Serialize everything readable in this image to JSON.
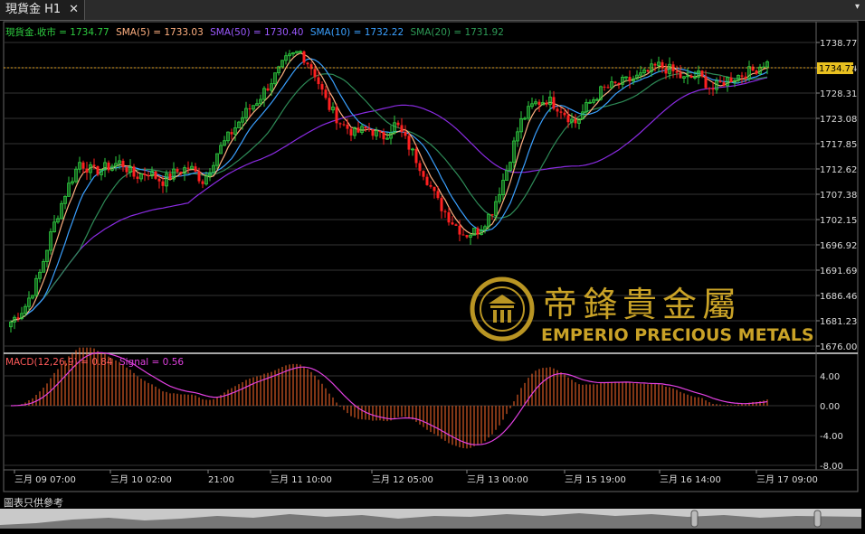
{
  "tab": {
    "label": "現貨金 H1",
    "close": "✕",
    "menu": "▾"
  },
  "legend": {
    "symbol": "現貨金.收市 = 1734.77",
    "sma5": "SMA(5) = 1733.03",
    "sma50": "SMA(50) = 1730.40",
    "sma10": "SMA(10) = 1732.22",
    "sma20": "SMA(20) = 1731.92"
  },
  "macd_legend": {
    "macd": "MACD(12,26,9) = 0.84",
    "signal": "Signal = 0.56"
  },
  "price_label": "1734.77",
  "disclaimer": "圖表只供參考",
  "watermark": {
    "name": "帝鋒貴金屬",
    "english": "EMPERIO PRECIOUS METALS"
  },
  "colors": {
    "up": "#2ecc40",
    "down": "#ff2020",
    "sma5": "#ffb080",
    "sma10": "#3aa0ff",
    "sma20": "#2e8b57",
    "sma50": "#8a2be2",
    "macd_hist": "#ff6a2a",
    "signal": "#e040e0",
    "gold": "#c9a227"
  },
  "chart_data": {
    "type": "candlestick",
    "price_axis": {
      "ticks": [
        "1738.77",
        "1733.54",
        "1728.31",
        "1723.08",
        "1717.85",
        "1712.62",
        "1707.38",
        "1702.15",
        "1696.92",
        "1691.69",
        "1686.46",
        "1681.23",
        "1676.00"
      ],
      "range": [
        1676.0,
        1741.0
      ]
    },
    "macd_axis": {
      "ticks": [
        "4.00",
        "0.00",
        "-4.00",
        "-8.00"
      ],
      "range": [
        -8.0,
        8.0
      ]
    },
    "time_labels": [
      "三月 09 07:00",
      "三月 10 02:00",
      "21:00",
      "三月 11 10:00",
      "三月 12 05:00",
      "三月 13 00:00",
      "三月 15 19:00",
      "三月 16 14:00",
      "三月 17 09:00"
    ],
    "last_close": 1734.77,
    "sma": {
      "sma5": 1733.03,
      "sma10": 1732.22,
      "sma20": 1731.92,
      "sma50": 1730.4
    },
    "macd": {
      "macd": 0.84,
      "signal": 0.56
    },
    "close_path": [
      1681,
      1684,
      1690,
      1700,
      1708,
      1714,
      1712,
      1713,
      1714,
      1711,
      1712,
      1710,
      1712,
      1713,
      1710,
      1716,
      1720,
      1724,
      1727,
      1731,
      1735,
      1737,
      1733,
      1726,
      1722,
      1720,
      1721,
      1719,
      1722,
      1717,
      1712,
      1706,
      1702,
      1699,
      1700,
      1704,
      1712,
      1722,
      1726,
      1727,
      1725,
      1722,
      1726,
      1729,
      1730,
      1731,
      1732,
      1734,
      1733,
      1731,
      1732,
      1729,
      1731,
      1732,
      1733,
      1735
    ]
  }
}
